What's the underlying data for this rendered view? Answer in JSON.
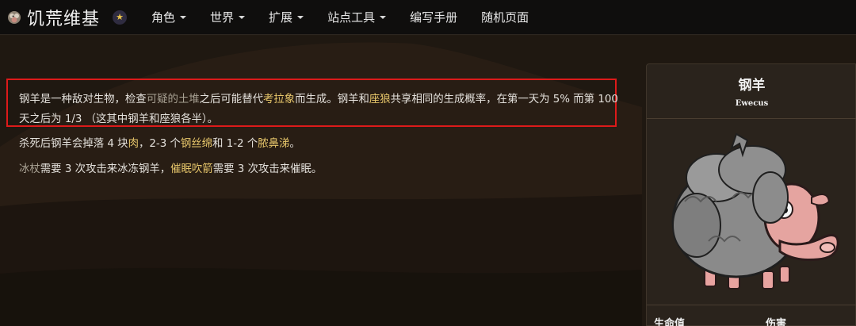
{
  "header": {
    "brand_title": "饥荒维基",
    "logo_icon": "ewecus-head-icon",
    "badge_icon": "star-icon",
    "nav": [
      {
        "label": "角色",
        "dropdown": true
      },
      {
        "label": "世界",
        "dropdown": true
      },
      {
        "label": "扩展",
        "dropdown": true
      },
      {
        "label": "站点工具",
        "dropdown": true
      },
      {
        "label": "编写手册",
        "dropdown": false
      },
      {
        "label": "随机页面",
        "dropdown": false
      }
    ]
  },
  "article": {
    "p1": {
      "t1": "钢羊是一种敌对生物，检查",
      "link_suspicious_dirt_pile": "可疑的土堆",
      "t2": "之后可能替代",
      "link_koalefant": "考拉象",
      "t3": "而生成。钢羊和",
      "link_varg": "座狼",
      "t4": "共享相同的生成概率，在第一天为 5% 而第 100 天之后为 1/3 （这其中钢羊和座狼各半）。"
    },
    "p2": {
      "t1": "杀死后钢羊会掉落 4 块",
      "link_meat": "肉",
      "t2": "，2-3 个",
      "link_steel_wool": "钢丝绵",
      "t3": "和 1-2 个",
      "link_phlegm": "脓鼻涕",
      "t4": "。"
    },
    "p3": {
      "link_ice_staff": "冰杖",
      "t1": "需要 3 次攻击来冰冻钢羊，",
      "link_sleep_dart": "催眠吹箭",
      "t2": "需要 3 次攻击来催眠。"
    }
  },
  "infobox": {
    "title": "钢羊",
    "subtitle": "Ewecus",
    "image_name": "ewecus-portrait",
    "stats": [
      {
        "label": "生命值"
      },
      {
        "label": "伤害"
      }
    ]
  },
  "colors": {
    "link_gold": "#e8c76b",
    "link_muted": "#a9a294",
    "highlight_border": "#dd1a1a",
    "navbar_bg": "#0f0e0d"
  }
}
